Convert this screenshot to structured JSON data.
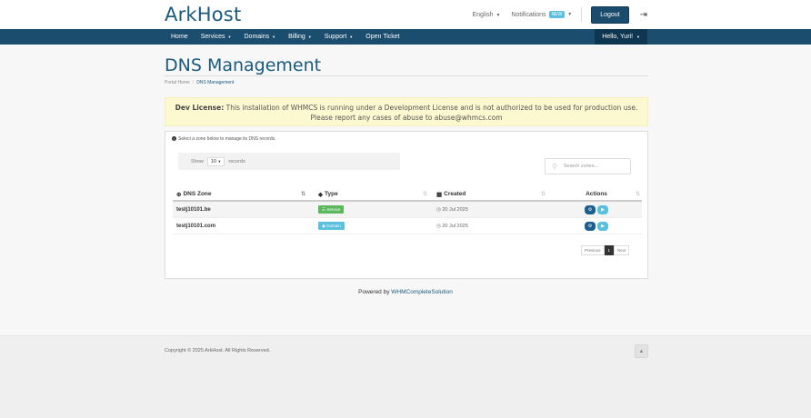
{
  "header": {
    "brand": "ArkHost",
    "language": "English",
    "notifications": "Notifications",
    "new_badge": "NEW",
    "logout": "Logout"
  },
  "nav": {
    "items": [
      {
        "label": "Home",
        "dropdown": false
      },
      {
        "label": "Services",
        "dropdown": true
      },
      {
        "label": "Domains",
        "dropdown": true
      },
      {
        "label": "Billing",
        "dropdown": true
      },
      {
        "label": "Support",
        "dropdown": true
      },
      {
        "label": "Open Ticket",
        "dropdown": false
      }
    ],
    "user": "Hello, Yuri!"
  },
  "page": {
    "title": "DNS Management",
    "breadcrumb": {
      "home": "Portal Home",
      "current": "DNS Management"
    }
  },
  "dev_notice": {
    "label": "Dev License:",
    "text": "This installation of WHMCS is running under a Development License and is not authorized to be used for production use. Please report any cases of abuse to abuse@whmcs.com"
  },
  "panel": {
    "info": "Select a zone below to manage its DNS records.",
    "show_label": "Show",
    "show_value": "10",
    "records_label": "records",
    "search_placeholder": "Search zones..."
  },
  "table": {
    "headers": {
      "zone": "DNS Zone",
      "type": "Type",
      "created": "Created",
      "actions": "Actions"
    },
    "rows": [
      {
        "zone": "testj10101.be",
        "type": "Service",
        "created": "20 Jul 2025"
      },
      {
        "zone": "testj10101.com",
        "type": "Domain",
        "created": "20 Jul 2025"
      }
    ]
  },
  "pager": {
    "previous": "Previous",
    "current": "1",
    "next": "Next"
  },
  "powered": {
    "prefix": "Powered by",
    "link": "WHMCompleteSolution"
  },
  "footer": {
    "copyright": "Copyright © 2025 ArkHost. All Rights Reserved."
  },
  "colors": {
    "brand": "#1a5a7e",
    "navbar": "#1b4d6e",
    "service": "#5cb85c",
    "domain": "#5bc0de",
    "notice": "#fcf8d0"
  }
}
